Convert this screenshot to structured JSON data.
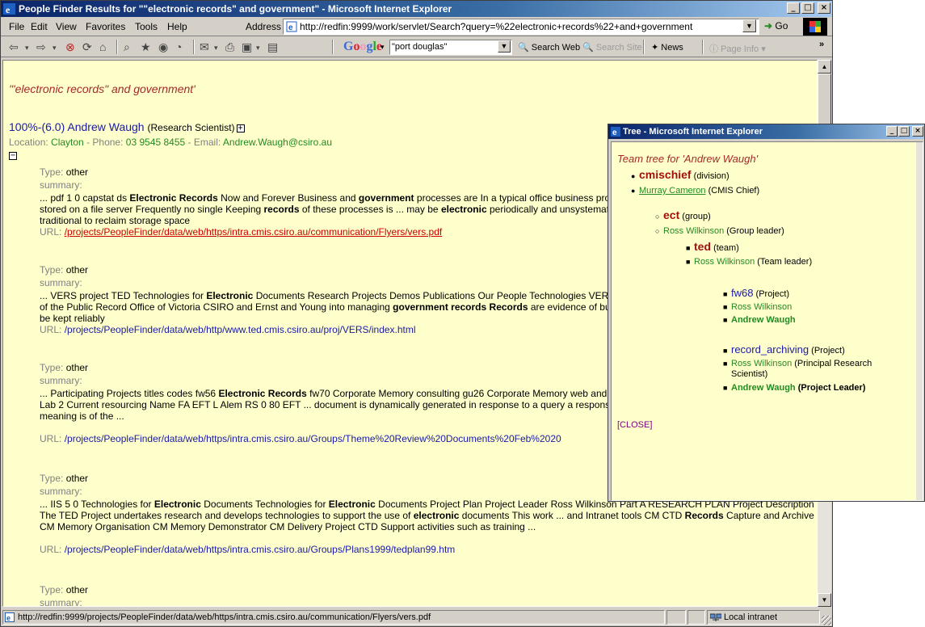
{
  "window": {
    "title": "People Finder Results for \"\"electronic records\" and government\" - Microsoft Internet Explorer",
    "controls": [
      "_",
      "□",
      "×"
    ]
  },
  "menubar": {
    "items": [
      "File",
      "Edit",
      "View",
      "Favorites",
      "Tools",
      "Help"
    ],
    "address_label": "Address",
    "address_value": "http://redfin:9999/work/servlet/Search?query=%22electronic+records%22+and+government",
    "go_label": "Go"
  },
  "toolbar": {
    "google_label": "Google",
    "google_query": "\"port douglas\"",
    "search_web": "Search Web",
    "search_site": "Search Site",
    "news": "News",
    "page_info": "Page Info"
  },
  "content": {
    "query_title": "'\"electronic records\" and government'",
    "person": {
      "score": "100%-(6.0)",
      "name": "Andrew Waugh",
      "role": "(Research Scientist)",
      "location_label": "Location:",
      "location": "Clayton",
      "phone_label": "- Phone:",
      "phone": "03 9545 8455",
      "email_label": "- Email:",
      "email": "Andrew.Waugh@csiro.au"
    },
    "results": [
      {
        "type_label": "Type:",
        "type": "other",
        "summary_label": "summary:",
        "snippet_html": "... pdf 1 0 capstat ds <b>Electronic Records</b> Now and Forever Business and <b>government</b> processes are In a typical office business processes are being conducted electronically stored on a file server Frequently no single Keeping <b>records</b> of these processes is ... may be <b>electronic</b> periodically and unsystematically culled <b>records</b> can be difficult because traditional to reclaim storage space",
        "url_label": "URL:",
        "url": "/projects/PeopleFinder/data/web/https/intra.cmis.csiro.au/communication/Flyers/vers.pdf"
      },
      {
        "type_label": "Type:",
        "type": "other",
        "summary_label": "summary:",
        "snippet_html": "... VERS project TED Technologies for <b>Electronic</b> Documents Research Projects Demos Publications Our People Technologies VERS Project The VERS project was a joint project of the Public Record Office of Victoria CSIRO and Ernst and Young into managing <b>government records Records</b> are evidence of business transactions <b>Electronic records</b> must be kept reliably",
        "url_label": "URL:",
        "url": "/projects/PeopleFinder/data/web/http/www.ted.cmis.csiro.au/proj/VERS/index.html"
      },
      {
        "type_label": "Type:",
        "type": "other",
        "summary_label": "summary:",
        "snippet_html": "... Participating Projects titles codes fw56 <b>Electronic Records</b> fw70 Corporate Memory consulting gu26 Corporate Memory web and email Healthy Country flagship the Knowledge Lab 2 Current resourcing Name FA EFT L Alem RS 0 80 EFT ... document is dynamically generated in response to a query a response given at a particular time and place Its meaning is of the ...",
        "url_label": "URL:",
        "url": "/projects/PeopleFinder/data/web/https/intra.cmis.csiro.au/Groups/Theme%20Review%20Documents%20Feb%2020"
      },
      {
        "type_label": "Type:",
        "type": "other",
        "summary_label": "summary:",
        "snippet_html": "... IIS 5 0 Technologies for <b>Electronic</b> Documents Technologies for <b>Electronic</b> Documents Project Plan Project Leader Ross Wilkinson Part A RESEARCH PLAN Project Description The TED Project undertakes research and develops technologies to support the use of <b>electronic</b> documents This work ... and Intranet tools CM CTD <b>Records</b> Capture and Archive CM Memory Organisation CM Memory Demonstrator CM Delivery Project CTD Support activities such as training ...",
        "url_label": "URL:",
        "url": "/projects/PeopleFinder/data/web/https/intra.cmis.csiro.au/Groups/Plans1999/tedplan99.htm"
      },
      {
        "type_label": "Type:",
        "type": "other",
        "summary_label": "summary:"
      }
    ]
  },
  "statusbar": {
    "url": "http://redfin:9999/projects/PeopleFinder/data/web/https/intra.cmis.csiro.au/communication/Flyers/vers.pdf",
    "zone": "Local intranet"
  },
  "popup": {
    "title": "Tree - Microsoft Internet Explorer",
    "tree_title": "Team tree for 'Andrew Waugh'",
    "nodes": {
      "cmischief": "cmischief",
      "cmischief_type": "(division)",
      "murray": "Murray Cameron",
      "murray_role": "(CMIS Chief)",
      "ect": "ect",
      "ect_type": "(group)",
      "ross1": "Ross Wilkinson",
      "ross1_role": "(Group leader)",
      "ted": "ted",
      "ted_type": "(team)",
      "ross2": "Ross Wilkinson",
      "ross2_role": "(Team leader)",
      "fw68": "fw68",
      "fw68_type": "(Project)",
      "ross3": "Ross Wilkinson",
      "andrew1": "Andrew Waugh",
      "record_archiving": "record_archiving",
      "record_archiving_type": "(Project)",
      "ross4": "Ross Wilkinson",
      "ross4_role_line1": "(Principal Research",
      "ross4_role_line2": "Scientist)",
      "andrew2": "Andrew Waugh",
      "andrew2_role": "(Project Leader)"
    },
    "close_label": "[CLOSE]"
  },
  "colors": {
    "page_bg": "#ffffcc",
    "title_red": "#a52a2a",
    "link_blue": "#1a1aa6",
    "green": "#228b22",
    "url_red": "#cc0000"
  }
}
